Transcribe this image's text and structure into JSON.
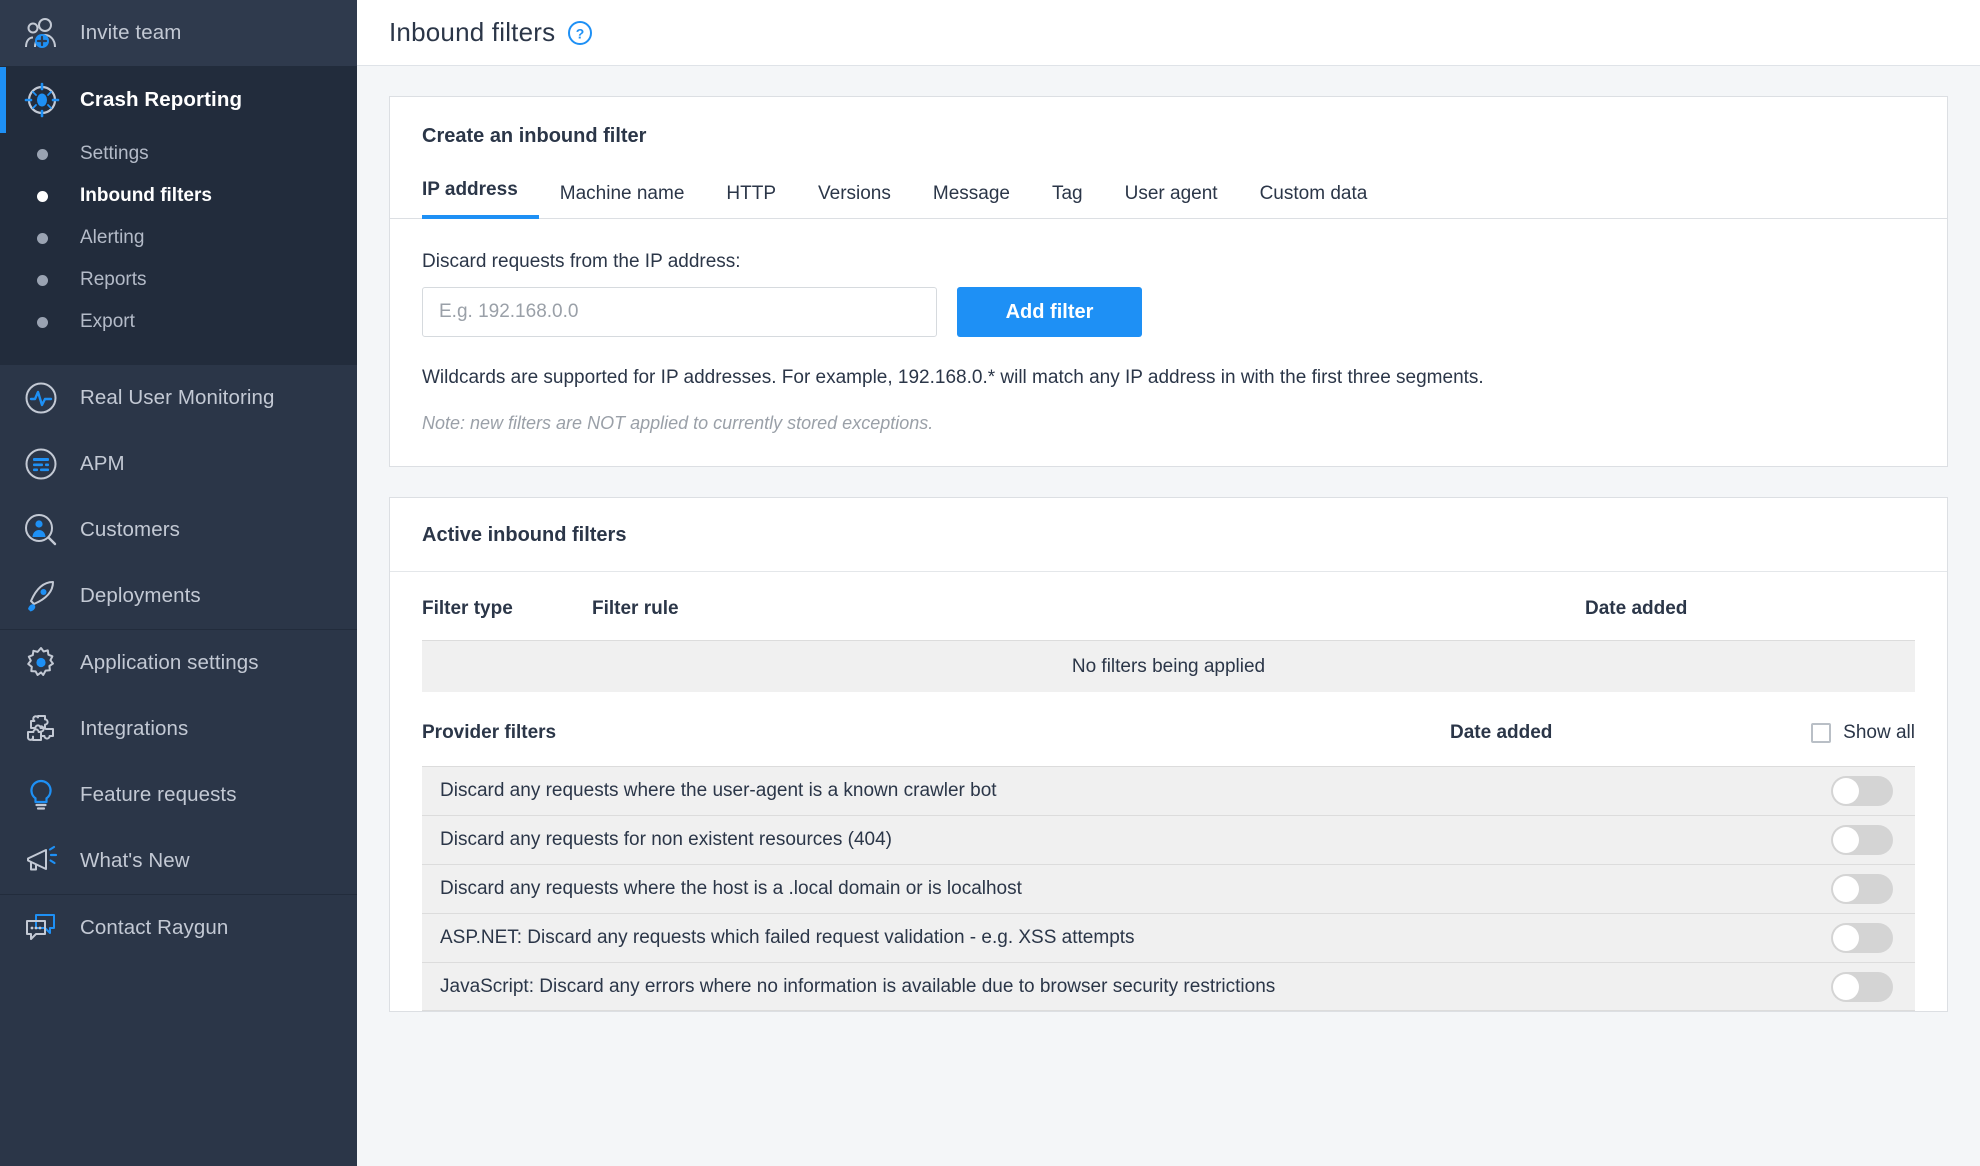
{
  "sidebar": {
    "invite": {
      "label": "Invite team",
      "icon": "invite-team-icon"
    },
    "product_label": "Crash Reporting",
    "product_icon": "crash-reporting-bug-icon",
    "sub_items": [
      {
        "label": "Settings",
        "selected": false
      },
      {
        "label": "Inbound filters",
        "selected": true
      },
      {
        "label": "Alerting",
        "selected": false
      },
      {
        "label": "Reports",
        "selected": false
      },
      {
        "label": "Export",
        "selected": false
      }
    ],
    "products": [
      {
        "label": "Real User Monitoring",
        "icon": "pulse-circle-icon"
      },
      {
        "label": "APM",
        "icon": "apm-circle-icon"
      },
      {
        "label": "Customers",
        "icon": "customer-search-icon"
      },
      {
        "label": "Deployments",
        "icon": "rocket-icon"
      }
    ],
    "settings_group": [
      {
        "label": "Application settings",
        "icon": "gear-icon"
      },
      {
        "label": "Integrations",
        "icon": "puzzle-icon"
      },
      {
        "label": "Feature requests",
        "icon": "lightbulb-icon"
      },
      {
        "label": "What's New",
        "icon": "megaphone-icon"
      }
    ],
    "contact": {
      "label": "Contact Raygun",
      "icon": "chat-bubbles-icon"
    }
  },
  "header": {
    "title": "Inbound filters",
    "help_icon": "question-circle-icon"
  },
  "create_card": {
    "title": "Create an inbound filter",
    "tabs": [
      {
        "label": "IP address",
        "active": true
      },
      {
        "label": "Machine name",
        "active": false
      },
      {
        "label": "HTTP",
        "active": false
      },
      {
        "label": "Versions",
        "active": false
      },
      {
        "label": "Message",
        "active": false
      },
      {
        "label": "Tag",
        "active": false
      },
      {
        "label": "User agent",
        "active": false
      },
      {
        "label": "Custom data",
        "active": false
      }
    ],
    "field_label": "Discard requests from the IP address:",
    "input_value": "",
    "input_placeholder": "E.g. 192.168.0.0",
    "submit_label": "Add filter",
    "help_text": "Wildcards are supported for IP addresses. For example, 192.168.0.* will match any IP address in with the first three segments.",
    "note_text": "Note: new filters are NOT applied to currently stored exceptions."
  },
  "active_card": {
    "title": "Active inbound filters",
    "columns": {
      "type": "Filter type",
      "rule": "Filter rule",
      "date": "Date added"
    },
    "empty_message": "No filters being applied",
    "provider_section": {
      "title": "Provider filters",
      "date_label": "Date added",
      "show_all_label": "Show all",
      "show_all_checked": false,
      "rows": [
        {
          "text": "Discard any requests where the user-agent is a known crawler bot",
          "enabled": false
        },
        {
          "text": "Discard any requests for non existent resources (404)",
          "enabled": false
        },
        {
          "text": "Discard any requests where the host is a .local domain or is localhost",
          "enabled": false
        },
        {
          "text": "ASP.NET: Discard any requests which failed request validation - e.g. XSS attempts",
          "enabled": false
        },
        {
          "text": "JavaScript: Discard any errors where no information is available due to browser security restrictions",
          "enabled": false
        }
      ]
    }
  },
  "colors": {
    "sidebar_bg": "#2b3648",
    "sidebar_active_bg": "#222c3c",
    "accent": "#1e90f5",
    "page_bg": "#f4f6f8",
    "row_bg": "#f0f0f0"
  }
}
